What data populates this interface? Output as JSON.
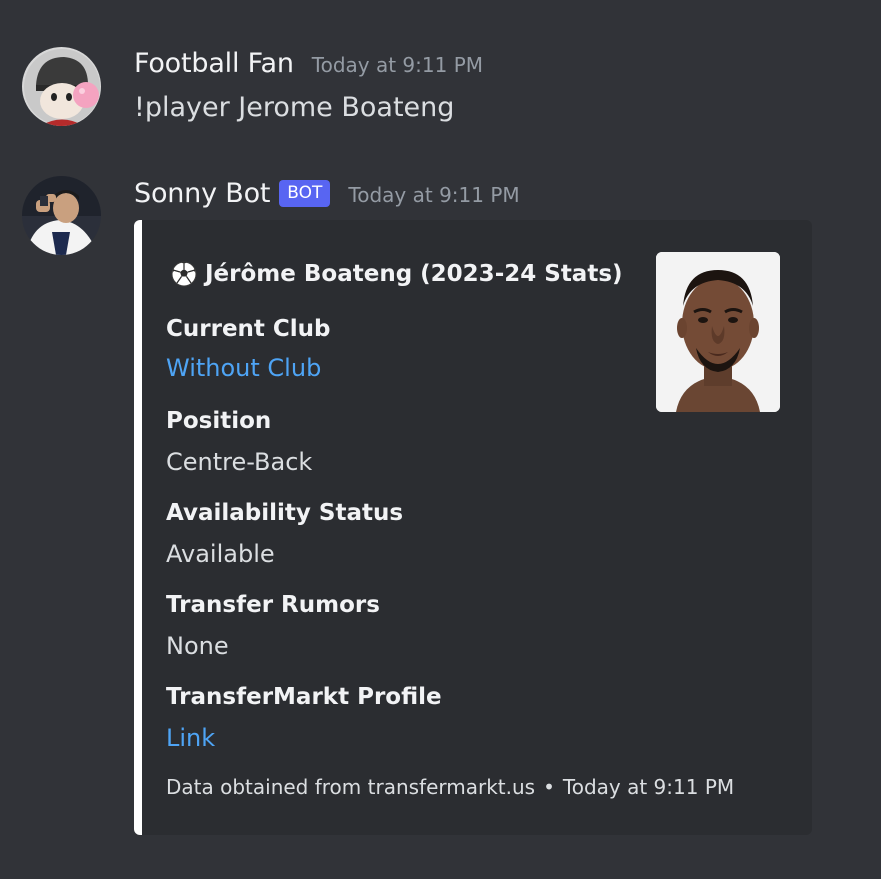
{
  "messages": [
    {
      "username": "Football Fan",
      "timestamp": "Today at 9:11 PM",
      "text": "!player Jerome Boateng"
    },
    {
      "username": "Sonny Bot",
      "badge": "BOT",
      "timestamp": "Today at 9:11 PM"
    }
  ],
  "embed": {
    "icon": "soccer-ball-icon",
    "title": "Jérôme Boateng (2023-24 Stats)",
    "bar_color": "#ffffff",
    "fields": [
      {
        "name": "Current Club",
        "value": "Without Club"
      },
      {
        "name": "Position",
        "value": "Centre-Back"
      },
      {
        "name": "Availability Status",
        "value": "Available"
      },
      {
        "name": "Transfer Rumors",
        "value": "None"
      },
      {
        "name": "TransferMarkt Profile",
        "value": "Link"
      }
    ],
    "footer": {
      "text": "Data obtained from transfermarkt.us",
      "separator": "•",
      "timestamp": "Today at 9:11 PM"
    }
  },
  "colors": {
    "background": "#313338",
    "embed_background": "#2b2d31",
    "link": "#4ea4f5",
    "bot_badge": "#5865f2"
  }
}
